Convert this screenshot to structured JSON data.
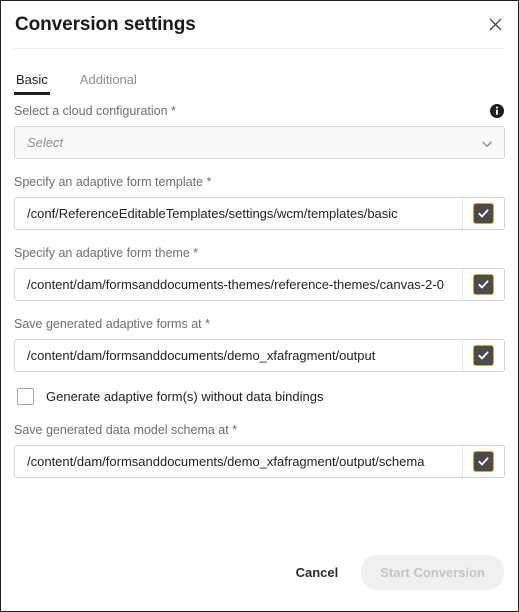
{
  "dialog": {
    "title": "Conversion settings",
    "close_icon": "close-icon"
  },
  "tabs": [
    {
      "label": "Basic",
      "active": true
    },
    {
      "label": "Additional",
      "active": false
    }
  ],
  "fields": {
    "cloud_config": {
      "label": "Select a cloud configuration *",
      "placeholder": "Select",
      "value": "",
      "info_icon": "info-icon",
      "chevron_icon": "chevron-down-icon"
    },
    "form_template": {
      "label": "Specify an adaptive form template *",
      "value": "/conf/ReferenceEditableTemplates/settings/wcm/templates/basic",
      "picker_icon": "checkbox-checked-icon"
    },
    "form_theme": {
      "label": "Specify an adaptive form theme *",
      "value": "/content/dam/formsanddocuments-themes/reference-themes/canvas-2-0",
      "picker_icon": "checkbox-checked-icon"
    },
    "forms_output": {
      "label": "Save generated adaptive forms at *",
      "value": "/content/dam/formsanddocuments/demo_xfafragment/output",
      "picker_icon": "checkbox-checked-icon"
    },
    "no_data_bindings": {
      "label": "Generate adaptive form(s) without data bindings",
      "checked": false
    },
    "schema_output": {
      "label": "Save generated data model schema at *",
      "value": "/content/dam/formsanddocuments/demo_xfafragment/output/schema",
      "picker_icon": "checkbox-checked-icon"
    }
  },
  "footer": {
    "cancel_label": "Cancel",
    "start_label": "Start Conversion",
    "start_disabled": true
  },
  "colors": {
    "text_primary": "#1f1f1f",
    "text_label": "#6e6e6e",
    "border": "#d6d6d6",
    "picker_fill": "#4b4b4b",
    "picker_focus": "#d9a441",
    "disabled_bg": "#f0f0f0",
    "disabled_text": "#c4c4c4"
  }
}
